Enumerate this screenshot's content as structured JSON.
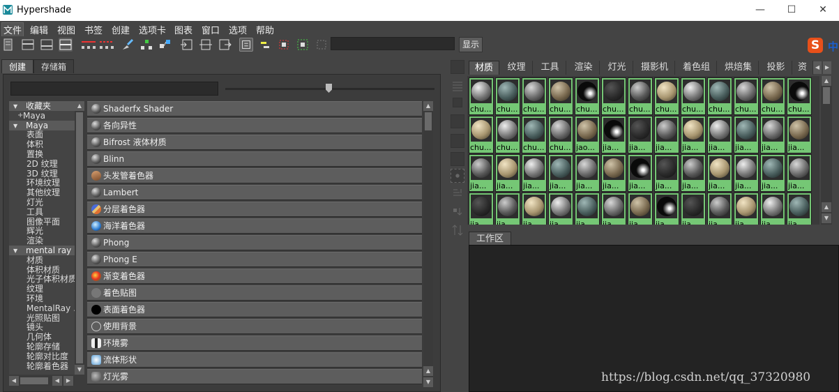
{
  "window": {
    "title": "Hypershade",
    "minimize": "—",
    "maximize": "☐",
    "close": "✕"
  },
  "menu": [
    "文件",
    "编辑",
    "视图",
    "书签",
    "创建",
    "选项卡",
    "图表",
    "窗口",
    "选项",
    "帮助"
  ],
  "toolbar": {
    "show_label": "显示"
  },
  "ime": {
    "s": "S",
    "zh": "中"
  },
  "left_tabs": [
    "创建",
    "存储箱"
  ],
  "tree": [
    {
      "label": "收藏夹",
      "hdr": true
    },
    {
      "label": "Maya",
      "plus": true
    },
    {
      "label": "Maya",
      "hdr": true
    },
    {
      "label": "表面"
    },
    {
      "label": "体积"
    },
    {
      "label": "置换"
    },
    {
      "label": "2D 纹理"
    },
    {
      "label": "3D 纹理"
    },
    {
      "label": "环境纹理"
    },
    {
      "label": "其他纹理"
    },
    {
      "label": "灯光"
    },
    {
      "label": "工具"
    },
    {
      "label": "图像平面"
    },
    {
      "label": "辉光"
    },
    {
      "label": "渲染"
    },
    {
      "label": "mental ray",
      "hdr": true
    },
    {
      "label": "材质"
    },
    {
      "label": "体积材质"
    },
    {
      "label": "光子体积材质"
    },
    {
      "label": "纹理"
    },
    {
      "label": "环境"
    },
    {
      "label": "MentalRay ..."
    },
    {
      "label": "光照贴图"
    },
    {
      "label": "镜头"
    },
    {
      "label": "几何体"
    },
    {
      "label": "轮廓存储"
    },
    {
      "label": "轮廓对比度"
    },
    {
      "label": "轮廓着色器"
    }
  ],
  "shaders": [
    {
      "label": "Shaderfx Shader",
      "icon": "sphere-dark"
    },
    {
      "label": "各向异性",
      "icon": "sphere-dark"
    },
    {
      "label": "Bifrost 液体材质",
      "icon": "sphere-dark"
    },
    {
      "label": "Blinn",
      "icon": "sphere-dark"
    },
    {
      "label": "头发管着色器",
      "icon": "hair"
    },
    {
      "label": "Lambert",
      "icon": "sphere-dark"
    },
    {
      "label": "分层着色器",
      "icon": "layered"
    },
    {
      "label": "海洋着色器",
      "icon": "ocean"
    },
    {
      "label": "Phong",
      "icon": "sphere-dark"
    },
    {
      "label": "Phong E",
      "icon": "sphere-dark"
    },
    {
      "label": "渐变着色器",
      "icon": "ramp"
    },
    {
      "label": "着色贴图",
      "icon": "flat-gray"
    },
    {
      "label": "表面着色器",
      "icon": "black"
    },
    {
      "label": "使用背景",
      "icon": "outline"
    },
    {
      "label": "环境雾",
      "icon": "envfog"
    },
    {
      "label": "流体形状",
      "icon": "fluid"
    },
    {
      "label": "灯光雾",
      "icon": "lightfog"
    }
  ],
  "right_tabs": [
    "材质",
    "纹理",
    "工具",
    "渲染",
    "灯光",
    "摄影机",
    "着色组",
    "烘焙集",
    "投影",
    "资源"
  ],
  "swatch_names": [
    [
      "chu...",
      "chu...",
      "chu...",
      "chu...",
      "chu...",
      "chu...",
      "chu...",
      "chu...",
      "chu...",
      "chu...",
      "chu...",
      "chu...",
      "chu..."
    ],
    [
      "chu...",
      "chu...",
      "chu...",
      "chu...",
      "jao...",
      "jia...",
      "jia...",
      "jia...",
      "jia...",
      "jia...",
      "jia...",
      "jia...",
      "jia..."
    ],
    [
      "jia...",
      "jia...",
      "jia...",
      "jia...",
      "jia...",
      "jia...",
      "jia...",
      "jia...",
      "jia...",
      "jia...",
      "jia...",
      "jia...",
      "jia..."
    ],
    [
      "jia...",
      "jia...",
      "jia...",
      "jia...",
      "jia...",
      "jia...",
      "jia...",
      "jia...",
      "jia...",
      "jia...",
      "jia...",
      "jia...",
      "jia..."
    ]
  ],
  "work_area": {
    "tab_label": "工作区"
  },
  "watermark": "https://blog.csdn.net/qq_37320980"
}
